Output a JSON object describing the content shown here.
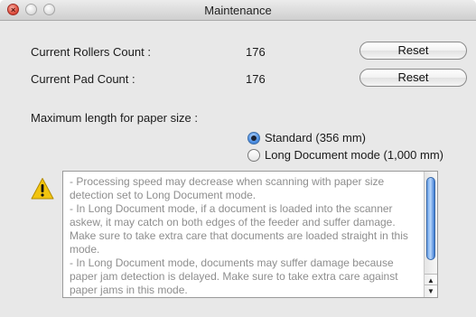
{
  "window": {
    "title": "Maintenance"
  },
  "counters": {
    "rollers_label": "Current Rollers Count :",
    "rollers_value": "176",
    "pad_label": "Current Pad Count :",
    "pad_value": "176",
    "reset_label": "Reset"
  },
  "paper_size": {
    "label": "Maximum length for paper size :",
    "options": [
      {
        "label": "Standard (356 mm)",
        "selected": true
      },
      {
        "label": "Long Document mode (1,000 mm)",
        "selected": false
      }
    ]
  },
  "notice": {
    "icon": "warning-icon",
    "text": "- Processing speed may decrease when scanning with paper size detection set to Long Document mode.\n- In Long Document mode, if a document is loaded into the scanner askew, it may catch on both edges of the feeder and suffer damage. Make sure to take extra care that documents are loaded straight in this mode.\n- In Long Document mode, documents may suffer damage because paper jam detection is delayed. Make sure to take extra care against paper jams in this mode."
  },
  "colors": {
    "accent": "#4c8fe3",
    "warning": "#f2c40f"
  }
}
